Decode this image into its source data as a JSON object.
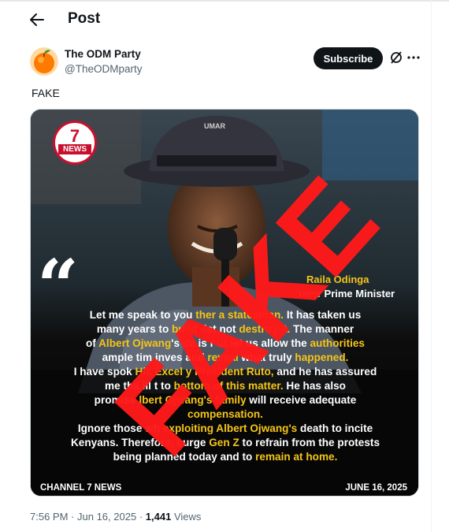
{
  "header": {
    "title": "Post"
  },
  "author": {
    "name": "The ODM Party",
    "handle": "@TheODMparty",
    "subscribe_label": "Subscribe"
  },
  "post": {
    "text": "FAKE"
  },
  "media": {
    "logo": {
      "number": "7",
      "word": "NEWS"
    },
    "quote_open": "“",
    "speaker_name": "Raila Odinga",
    "speaker_title": "rmer Prime Minister",
    "quote_lines": [
      [
        {
          "t": "Let me speak to you"
        },
        {
          "t": "            "
        },
        {
          "t": "ther a",
          "h": true
        },
        {
          "t": "  "
        },
        {
          "t": "statesman.",
          "h": true
        },
        {
          "t": " It has taken us"
        }
      ],
      [
        {
          "t": "many years to "
        },
        {
          "t": "build",
          "h": true
        },
        {
          "t": "           "
        },
        {
          "t": "-let",
          "h": false
        },
        {
          "t": "   not "
        },
        {
          "t": "destroy it.",
          "h": true
        },
        {
          "t": " The manner"
        }
      ],
      [
        {
          "t": "of "
        },
        {
          "t": "Albert Ojwang",
          "h": true
        },
        {
          "t": "'s de"
        },
        {
          "t": "    "
        },
        {
          "t": "is r"
        },
        {
          "t": "          "
        },
        {
          "t": "ut let us allow the "
        },
        {
          "t": "authorities",
          "h": true
        }
      ],
      [
        {
          "t": "ample tim"
        },
        {
          "t": "    "
        },
        {
          "t": "inves",
          "h": false
        },
        {
          "t": "       "
        },
        {
          "t": "and "
        },
        {
          "t": "reveal",
          "h": true
        },
        {
          "t": " what truly "
        },
        {
          "t": "happened.",
          "h": true
        }
      ],
      [
        {
          "t": "I have spok"
        },
        {
          "t": "      "
        },
        {
          "t": "His Excel",
          "h": true
        },
        {
          "t": "    "
        },
        {
          "t": "y President Ruto,",
          "h": true
        },
        {
          "t": " and he has assured"
        }
      ],
      [
        {
          "t": "me tha"
        },
        {
          "t": "         "
        },
        {
          "t": "ill "
        },
        {
          "t": "  "
        },
        {
          "t": "t to "
        },
        {
          "t": "  "
        },
        {
          "t": "bottom of this matter.",
          "h": true
        },
        {
          "t": " He has also"
        }
      ],
      [
        {
          "t": "promise"
        },
        {
          "t": "      "
        },
        {
          "t": "lbert Ojwang's family",
          "h": true
        },
        {
          "t": " will receive adequate"
        }
      ],
      [
        {
          "t": "compensation.",
          "h": true
        }
      ],
      [
        {
          "t": "Ignore those wh"
        },
        {
          "t": "      "
        },
        {
          "t": "exploiting Albert Ojwang's",
          "h": true
        },
        {
          "t": " death to incite"
        }
      ],
      [
        {
          "t": "Kenyans. Therefore, I urge "
        },
        {
          "t": "Gen Z",
          "h": true
        },
        {
          "t": " to refrain from the protests"
        }
      ],
      [
        {
          "t": "being planned today and to "
        },
        {
          "t": "remain at home.",
          "h": true
        }
      ]
    ],
    "footer_left": "CHANNEL 7 NEWS",
    "footer_right": "JUNE 16, 2025",
    "stamp_text": "FAKE"
  },
  "meta": {
    "time": "7:56 PM",
    "date": "Jun 16, 2025",
    "views_count": "1,441",
    "views_label": "Views"
  },
  "colors": {
    "accent_red": "#ff1a1a",
    "highlight_yellow": "#f5c518",
    "subscribe_bg": "#0f1419",
    "muted": "#536471"
  }
}
